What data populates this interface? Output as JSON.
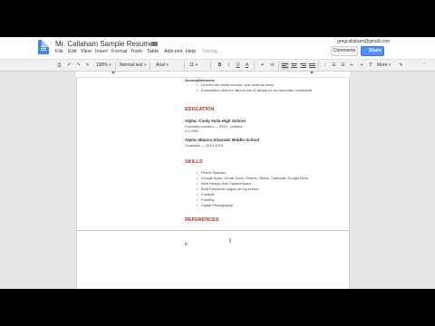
{
  "app": {
    "title": "Mr. Callaham Sample Resume",
    "account_email": "gregcallaham@gmail.com",
    "comments_label": "Comments",
    "share_label": "Share"
  },
  "menu": {
    "items": [
      "File",
      "Edit",
      "View",
      "Insert",
      "Format",
      "Tools",
      "Table",
      "Add-ons",
      "Help"
    ],
    "last_edit": "Saving..."
  },
  "toolbar": {
    "zoom": "100%",
    "style": "Normal text",
    "font": "Arial",
    "size": "11",
    "bold": "B",
    "italic": "I",
    "underline": "U",
    "text_color": "A",
    "link": "⚭",
    "comment": "✉",
    "line_spacing": "↕",
    "numbered_list": "☰",
    "bullet_list": "☰",
    "indent_less": "⇤",
    "indent_more": "⇥",
    "clear_format": "T̸",
    "more": "More",
    "edit_mode": "✎",
    "collapse": "⌃"
  },
  "document": {
    "top_fragment": "Accomplishments",
    "top_bullets": [
      "Ut enim ad minim veniam, quis nostrud exerc",
      "Exercitation ullamco laboris nisi ut aliquip ex ea commodo consequat"
    ],
    "education": {
      "heading": "EDUCATION",
      "schools": [
        {
          "name": "Alpha: Cindy Avila High School",
          "detail1": "Currently enrolled — 2015 - present",
          "detail2": "4.0 GPA"
        },
        {
          "name": "Alpha: Blanca Alvarado Middle School",
          "detail1": "Graduate — 2012-2015"
        }
      ]
    },
    "skills": {
      "heading": "SKILLS",
      "items": [
        "Fluent Spanish",
        "Google Apps: Gmail, Docs, Sheets, Slides, Calendar, Google Drive",
        "Web Design with SquareSpace",
        "Built Facebook pages for my school",
        "Football",
        "Painting",
        "Digital Photography"
      ]
    },
    "references": {
      "heading": "REFERENCES",
      "next_page_text": "b"
    }
  },
  "cursor_glyph": "I"
}
